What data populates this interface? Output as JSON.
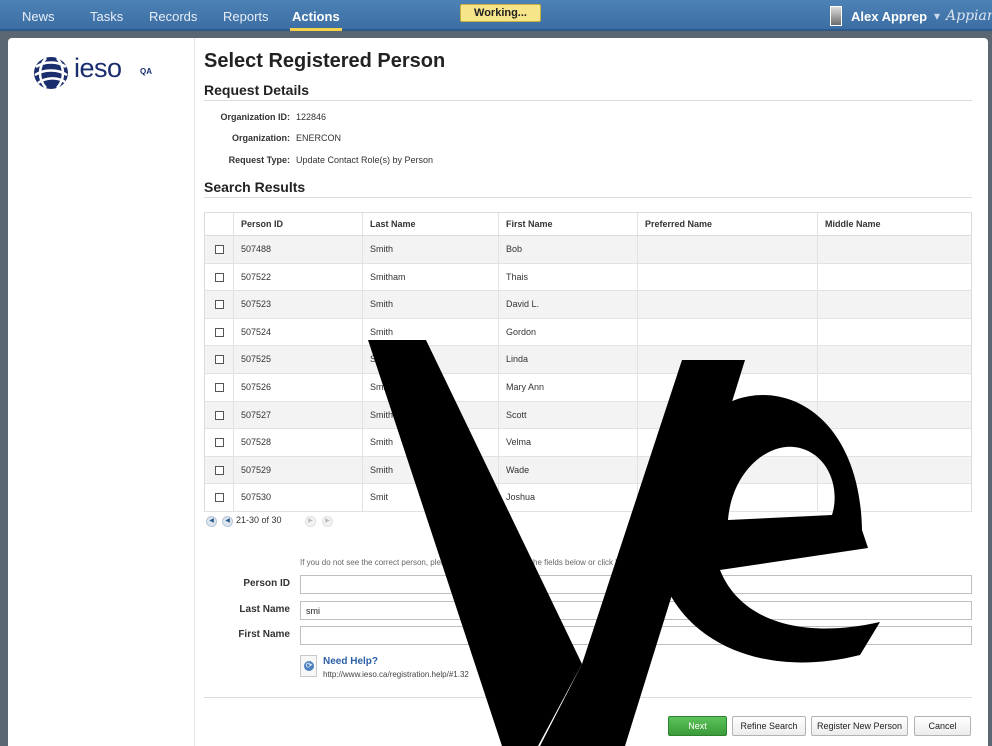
{
  "nav": {
    "items": [
      {
        "label": "News",
        "active": false
      },
      {
        "label": "Tasks",
        "active": false
      },
      {
        "label": "Records",
        "active": false
      },
      {
        "label": "Reports",
        "active": false
      },
      {
        "label": "Actions",
        "active": true
      }
    ],
    "status": "Working...",
    "user": "Alex Apprep",
    "user_chevron": "▾",
    "brand": "Appian"
  },
  "logo": {
    "text": "ieso",
    "badge": "QA"
  },
  "page": {
    "title": "Select Registered Person"
  },
  "request_details": {
    "heading": "Request Details",
    "fields": [
      {
        "label": "Organization ID:",
        "value": "122846"
      },
      {
        "label": "Organization:",
        "value": "ENERCON"
      },
      {
        "label": "Request Type:",
        "value": "Update Contact Role(s) by Person"
      }
    ]
  },
  "results": {
    "heading": "Search Results",
    "columns": [
      "Person ID",
      "Last Name",
      "First Name",
      "Preferred Name",
      "Middle Name"
    ],
    "rows": [
      {
        "person_id": "507488",
        "last_name": "Smith",
        "first_name": "Bob",
        "preferred_name": "",
        "middle_name": ""
      },
      {
        "person_id": "507522",
        "last_name": "Smitham",
        "first_name": "Thais",
        "preferred_name": "",
        "middle_name": ""
      },
      {
        "person_id": "507523",
        "last_name": "Smith",
        "first_name": "David L.",
        "preferred_name": "",
        "middle_name": ""
      },
      {
        "person_id": "507524",
        "last_name": "Smith",
        "first_name": "Gordon",
        "preferred_name": "",
        "middle_name": ""
      },
      {
        "person_id": "507525",
        "last_name": "Smith",
        "first_name": "Linda",
        "preferred_name": "",
        "middle_name": ""
      },
      {
        "person_id": "507526",
        "last_name": "Smith",
        "first_name": "Mary Ann",
        "preferred_name": "",
        "middle_name": ""
      },
      {
        "person_id": "507527",
        "last_name": "Smith",
        "first_name": "Scott",
        "preferred_name": "",
        "middle_name": ""
      },
      {
        "person_id": "507528",
        "last_name": "Smith",
        "first_name": "Velma",
        "preferred_name": "",
        "middle_name": ""
      },
      {
        "person_id": "507529",
        "last_name": "Smith",
        "first_name": "Wade",
        "preferred_name": "",
        "middle_name": ""
      },
      {
        "person_id": "507530",
        "last_name": "Smit",
        "first_name": "Joshua",
        "preferred_name": "",
        "middle_name": ""
      }
    ],
    "pager": {
      "range": "21-30 of 30"
    }
  },
  "refine": {
    "hint": "If you do not see the correct person, please refine your search in the fields below or click 'Register New Person'.",
    "person_id": {
      "label": "Person ID",
      "value": ""
    },
    "last_name": {
      "label": "Last Name",
      "value": "smi"
    },
    "first_name": {
      "label": "First Name",
      "value": ""
    }
  },
  "help": {
    "title": "Need Help?",
    "url": "http://www.ieso.ca/registration.help/#1.32"
  },
  "actions": {
    "next": "Next",
    "refine": "Refine Search",
    "register": "Register New Person",
    "cancel": "Cancel"
  },
  "colors": {
    "nav_bar": "#3c6ea3",
    "active_underline": "#f3d34a",
    "primary_button": "#3b9b39",
    "logo_blue": "#1a2e6e"
  }
}
